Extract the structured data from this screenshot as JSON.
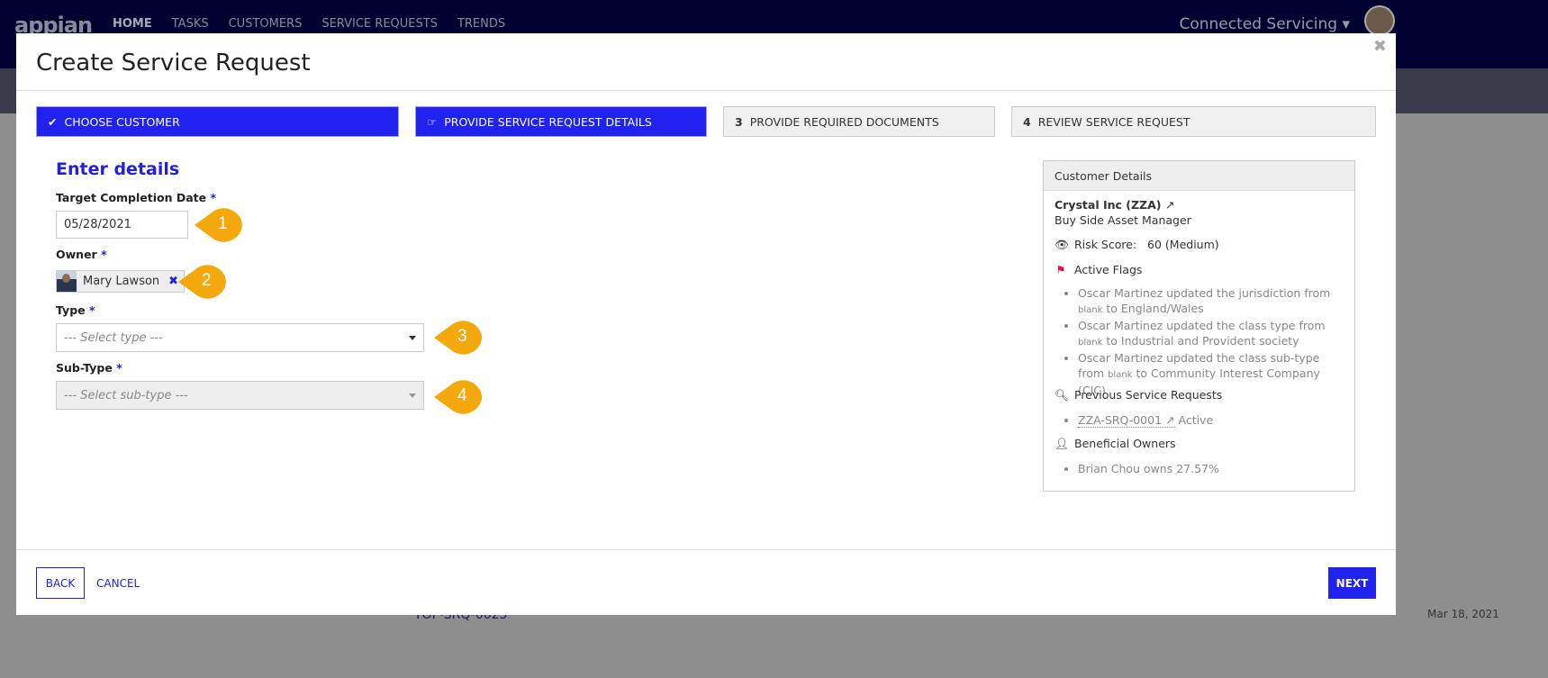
{
  "topnav": {
    "logo": "appian",
    "items": [
      "HOME",
      "TASKS",
      "CUSTOMERS",
      "SERVICE REQUESTS",
      "TRENDS"
    ],
    "app_name": "Connected Servicing ▾"
  },
  "background": {
    "item1": "TOP-SRQ-0025",
    "date": "Mar 18, 2021"
  },
  "modal": {
    "title": "Create Service Request",
    "close": "✖",
    "steps": [
      {
        "label": "CHOOSE CUSTOMER",
        "marker": "✔",
        "state": "done"
      },
      {
        "label": "PROVIDE SERVICE REQUEST DETAILS",
        "marker": "☞",
        "state": "current"
      },
      {
        "label": "PROVIDE REQUIRED DOCUMENTS",
        "marker": "3",
        "state": "todo"
      },
      {
        "label": "REVIEW SERVICE REQUEST",
        "marker": "4",
        "state": "todo"
      }
    ],
    "section_title": "Enter details",
    "fields": {
      "date_label": "Target Completion Date",
      "date_value": "05/28/2021",
      "owner_label": "Owner",
      "owner_value": "Mary Lawson",
      "type_label": "Type",
      "type_placeholder": "--- Select type ---",
      "subtype_label": "Sub-Type",
      "subtype_placeholder": "--- Select sub-type ---",
      "required": "*"
    },
    "callouts": [
      "1",
      "2",
      "3",
      "4"
    ],
    "callout_color": "#f5a80c",
    "customer": {
      "header": "Customer Details",
      "name": "Crystal Inc (ZZA)",
      "type": "Buy Side Asset Manager",
      "risk_label": "Risk Score:",
      "risk_value": "60 (Medium)",
      "flags_label": "Active Flags",
      "flags": [
        {
          "a": "Oscar Martinez updated the jurisdiction from ",
          "blank": "blank",
          "b": " to England/Wales"
        },
        {
          "a": "Oscar Martinez updated the class type from ",
          "blank": "blank",
          "b": " to Industrial and Provident society"
        },
        {
          "a": "Oscar Martinez updated the class sub-type from ",
          "blank": "blank",
          "b": " to Community Interest Company (CIC)"
        }
      ],
      "prev_label": "Previous Service Requests",
      "prev_id": "ZZA-SRQ-0001",
      "prev_status": "Active",
      "owners_label": "Beneficial Owners",
      "owner_item": "Brian Chou owns 27.57%"
    },
    "footer": {
      "back": "BACK",
      "cancel": "CANCEL",
      "next": "NEXT"
    }
  },
  "colors": {
    "primary": "#2222ee",
    "flag": "#e0143c"
  }
}
